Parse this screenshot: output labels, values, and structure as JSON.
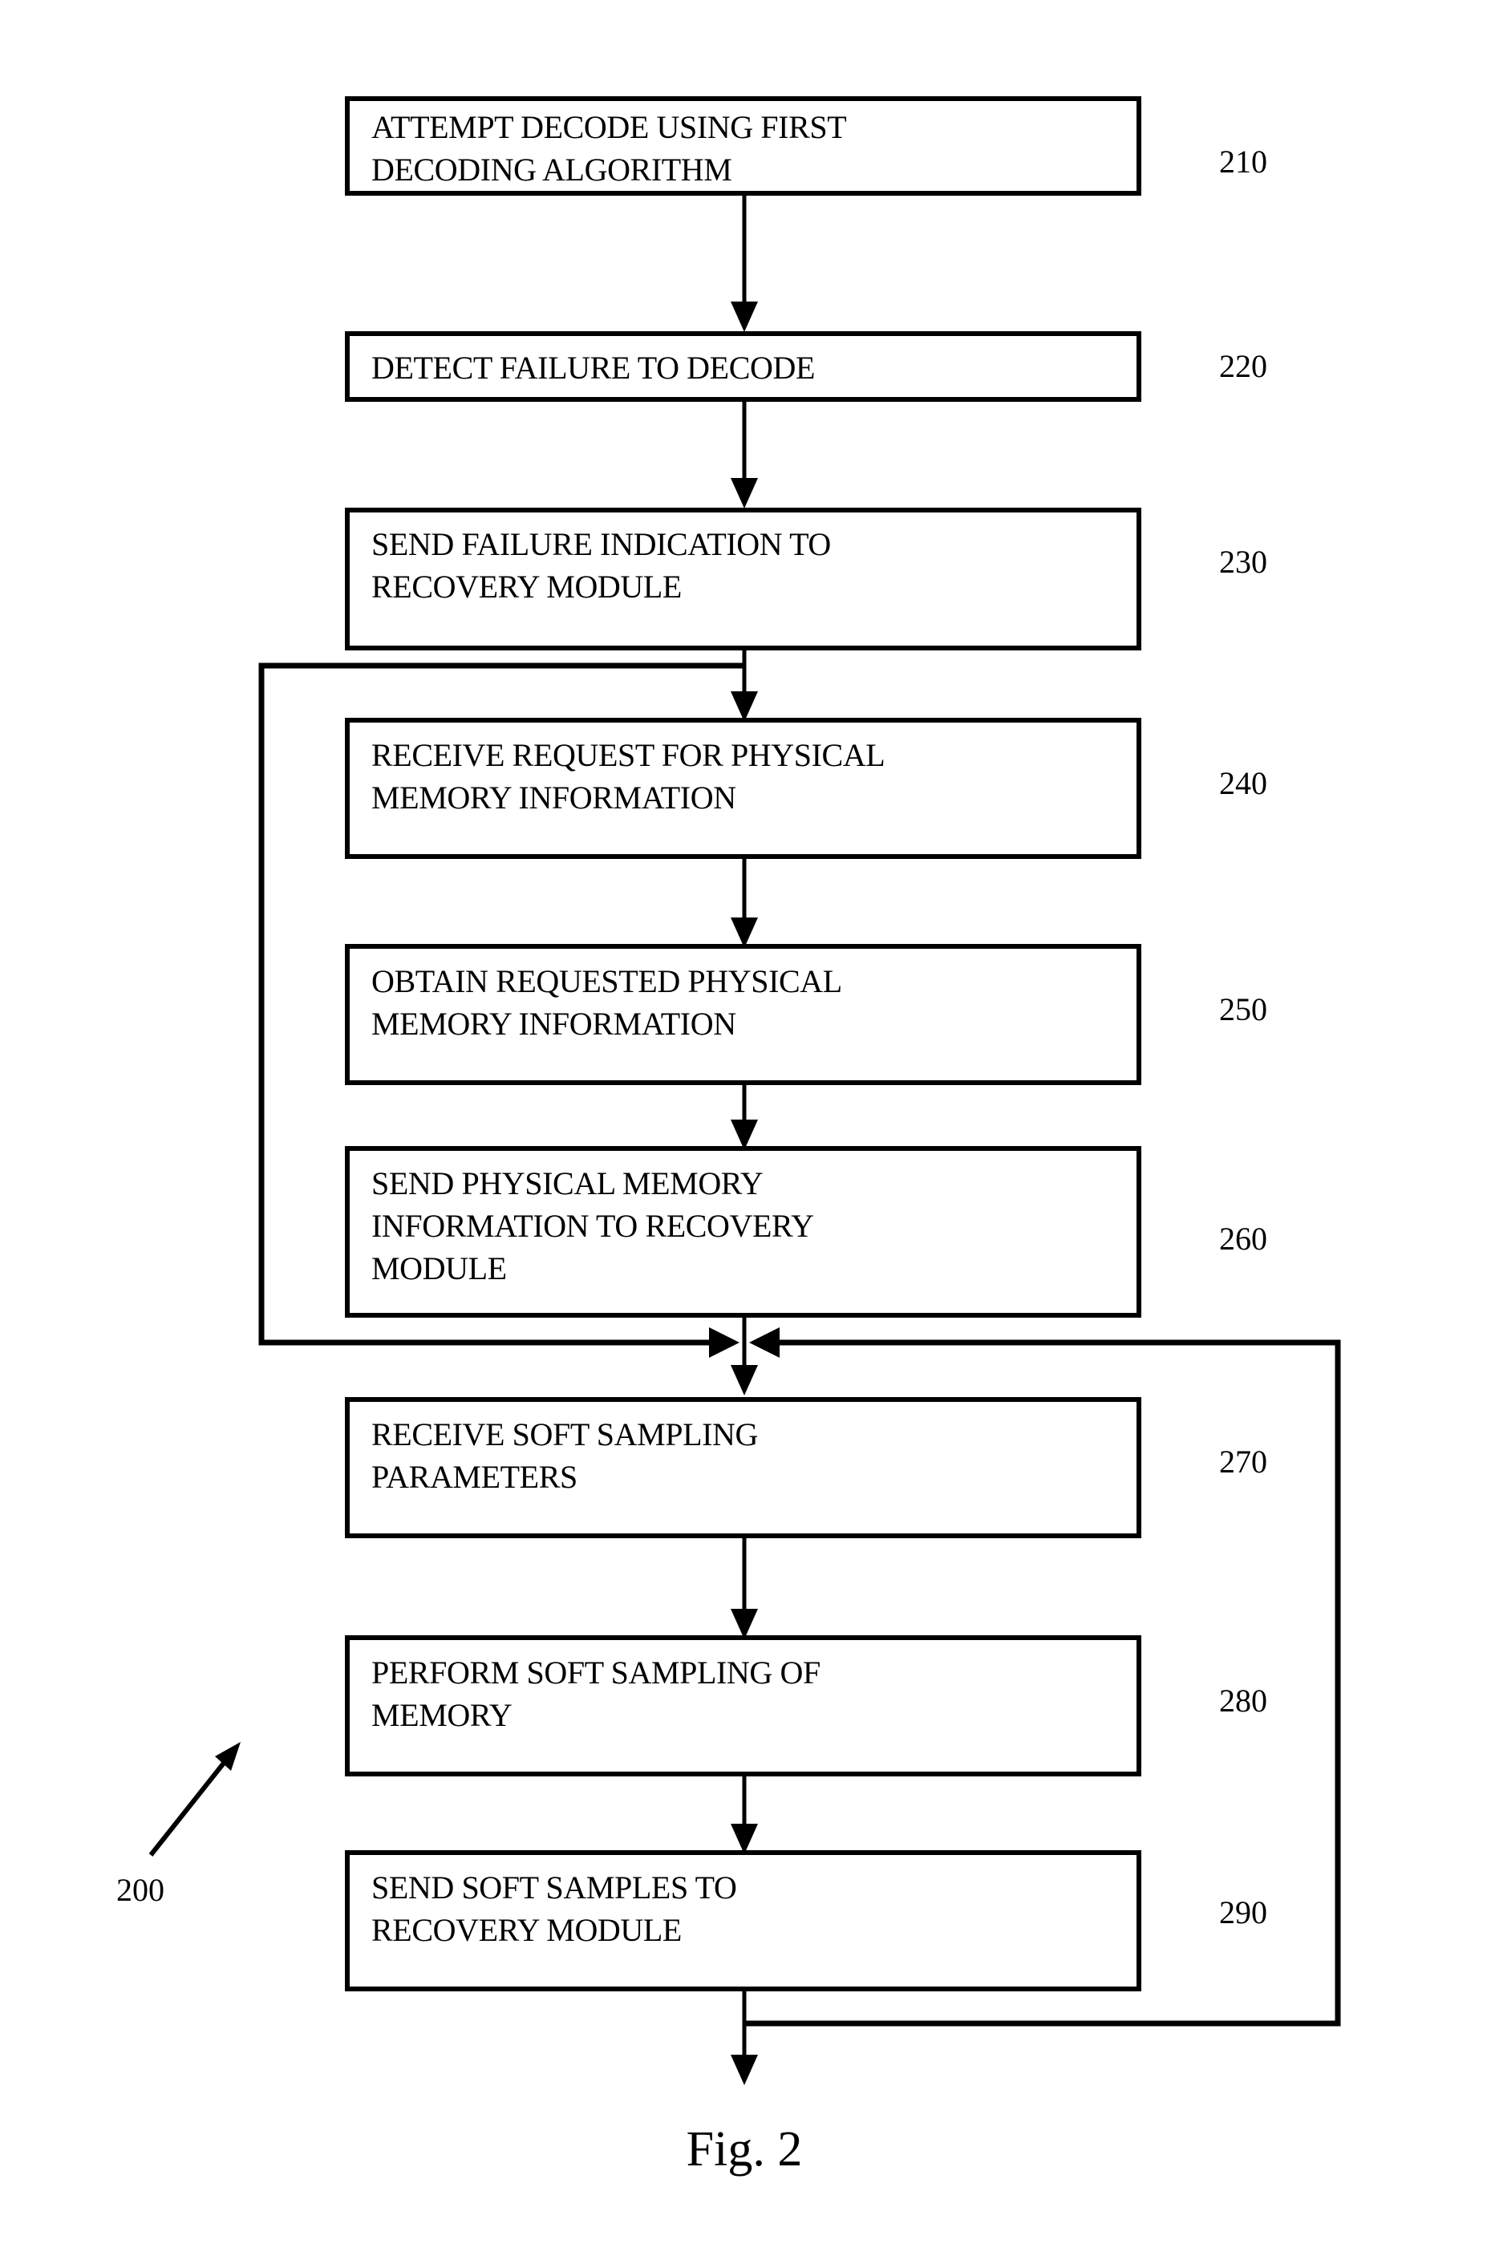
{
  "figure": {
    "caption": "Fig. 2",
    "diagram_ref": "200",
    "type": "patent-flowchart"
  },
  "steps": [
    {
      "ref": "210",
      "lines": [
        "ATTEMPT DECODE USING FIRST",
        "DECODING ALGORITHM"
      ],
      "text": "ATTEMPT DECODE USING FIRST DECODING ALGORITHM"
    },
    {
      "ref": "220",
      "lines": [
        "DETECT FAILURE TO DECODE"
      ],
      "text": "DETECT FAILURE TO DECODE"
    },
    {
      "ref": "230",
      "lines": [
        "SEND FAILURE INDICATION TO",
        "RECOVERY MODULE"
      ],
      "text": "SEND FAILURE INDICATION TO RECOVERY MODULE"
    },
    {
      "ref": "240",
      "lines": [
        "RECEIVE REQUEST FOR PHYSICAL",
        "MEMORY INFORMATION"
      ],
      "text": "RECEIVE REQUEST FOR PHYSICAL MEMORY INFORMATION"
    },
    {
      "ref": "250",
      "lines": [
        "OBTAIN REQUESTED PHYSICAL",
        "MEMORY INFORMATION"
      ],
      "text": "OBTAIN REQUESTED PHYSICAL MEMORY INFORMATION"
    },
    {
      "ref": "260",
      "lines": [
        "SEND PHYSICAL MEMORY",
        "INFORMATION TO RECOVERY",
        "MODULE"
      ],
      "text": "SEND PHYSICAL MEMORY INFORMATION TO RECOVERY MODULE"
    },
    {
      "ref": "270",
      "lines": [
        "RECEIVE SOFT SAMPLING",
        "PARAMETERS"
      ],
      "text": "RECEIVE SOFT SAMPLING PARAMETERS"
    },
    {
      "ref": "280",
      "lines": [
        "PERFORM SOFT SAMPLING OF",
        "MEMORY"
      ],
      "text": "PERFORM SOFT SAMPLING OF MEMORY"
    },
    {
      "ref": "290",
      "lines": [
        "SEND SOFT SAMPLES TO",
        "RECOVERY MODULE"
      ],
      "text": "SEND SOFT SAMPLES TO RECOVERY MODULE"
    }
  ],
  "colors": {
    "stroke": "#000000",
    "fill": "#ffffff",
    "text": "#000000"
  }
}
